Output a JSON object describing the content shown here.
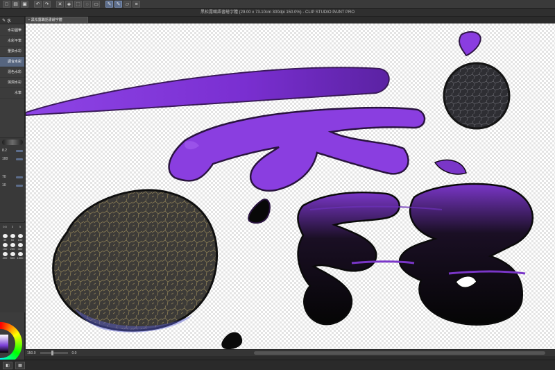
{
  "app": {
    "title": "黑松露職語書繪字體 (29.00 x 73.10cm 300dpi 150.0%) - CLIP STUDIO PAINT PRO"
  },
  "document_tab": {
    "label": "黑松露職語書繪字體"
  },
  "toolbar": {
    "icons": [
      "new-file-icon",
      "open-file-icon",
      "save-icon",
      "undo-icon",
      "redo-icon",
      "clear-icon",
      "fill-icon",
      "transform-icon",
      "selection-icon",
      "ruler-icon",
      "pen-icon",
      "brush-icon",
      "eraser-icon",
      "menu-icon"
    ]
  },
  "sub_tool": {
    "header_label": "水",
    "items": [
      {
        "label": "水彩圓筆",
        "active": false
      },
      {
        "label": "水彩平筆",
        "active": false
      },
      {
        "label": "暈染水彩",
        "active": false
      },
      {
        "label": "調合水彩",
        "active": true
      },
      {
        "label": "混色水彩",
        "active": false
      },
      {
        "label": "濕潤水彩",
        "active": false
      },
      {
        "label": "水筆",
        "active": false
      }
    ]
  },
  "tool_properties": {
    "brush_size": "8.2",
    "opacity": "100",
    "paint_amount": "70",
    "paint_density": "10"
  },
  "brush_sizes": [
    "0.5",
    "3",
    "5",
    "40",
    "50",
    "100",
    "150",
    "200",
    "300",
    "400",
    "500",
    "1000"
  ],
  "status": {
    "zoom": "150.0",
    "rotation": "0.0"
  },
  "colors": {
    "accent": "#5d6e8c",
    "purple": "#7b3fd6",
    "ink": "#0b0b0b",
    "truffle": "#3c3a38"
  }
}
